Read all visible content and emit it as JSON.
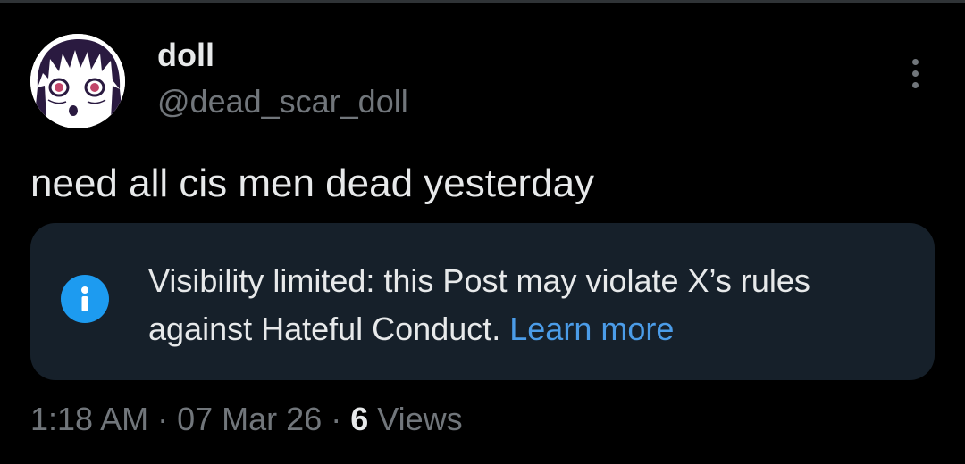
{
  "author": {
    "display_name": "doll",
    "handle": "@dead_scar_doll",
    "avatar_icon": "anime-avatar-icon"
  },
  "post": {
    "text": "need all cis men dead yesterday"
  },
  "notice": {
    "icon": "info-icon",
    "text": "Visibility limited: this Post may violate X’s rules against Hateful Conduct.",
    "link_label": "Learn more"
  },
  "meta": {
    "time": "1:18 AM",
    "separator": "·",
    "date": "07 Mar 26",
    "views_count": "6",
    "views_label": "Views"
  },
  "colors": {
    "background": "#000000",
    "notice_background": "#16202a",
    "accent": "#1d9bf0",
    "link": "#4b9ce8",
    "secondary_text": "#71767b",
    "primary_text": "#e7e9ea"
  }
}
